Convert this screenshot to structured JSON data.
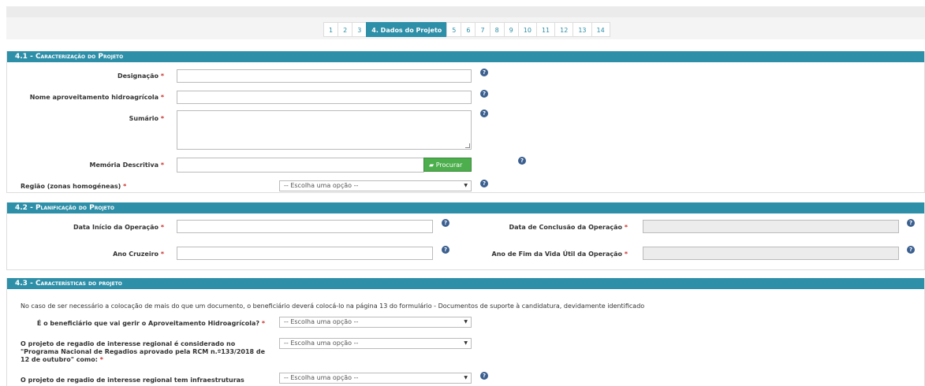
{
  "pager": {
    "items": [
      "1",
      "2",
      "3",
      "4. Dados do Projeto",
      "5",
      "6",
      "7",
      "8",
      "9",
      "10",
      "11",
      "12",
      "13",
      "14"
    ],
    "active_index": 3
  },
  "section1": {
    "title": "4.1 - Caracterização do Projeto",
    "designacao_label": "Designação",
    "nome_label": "Nome aproveitamento hidroagrícola",
    "sumario_label": "Sumário",
    "memoria_label": "Memória Descritiva",
    "procurar_label": "Procurar",
    "regiao_label": "Região (zonas homogéneas)",
    "regiao_value": "-- Escolha uma opção --"
  },
  "section2": {
    "title": "4.2 - Planificação do Projeto",
    "data_inicio_label": "Data Início da Operação",
    "data_conclusao_label": "Data de Conclusão da Operação",
    "ano_cruzeiro_label": "Ano Cruzeiro",
    "ano_fim_label": "Ano de Fim da Vida Útil da Operação"
  },
  "section3": {
    "title": "4.3 - Características do projeto",
    "note": "No caso de ser necessário a colocação de mais do que um documento, o beneficiário deverá colocá-lo na página 13 do formulário - Documentos de suporte à candidatura, devidamente identificado",
    "q1_label": "É o beneficiário que vai gerir o Aproveitamento Hidroagrícola?",
    "q1_value": "-- Escolha uma opção --",
    "q2_line1": "O projeto de regadio de interesse regional é considerado no",
    "q2_line2": "\"Programa Nacional de Regadios aprovado pela RCM n.º133/2018 de",
    "q2_line3": "12 de outubro\" como:",
    "q2_value": "-- Escolha uma opção --",
    "q3_label": "O projeto de regadio de interesse regional tem infraestruturas",
    "q3_value": "-- Escolha uma opção --"
  },
  "common": {
    "required_mark": "*",
    "help_glyph": "?",
    "arrow_glyph": "▼"
  }
}
